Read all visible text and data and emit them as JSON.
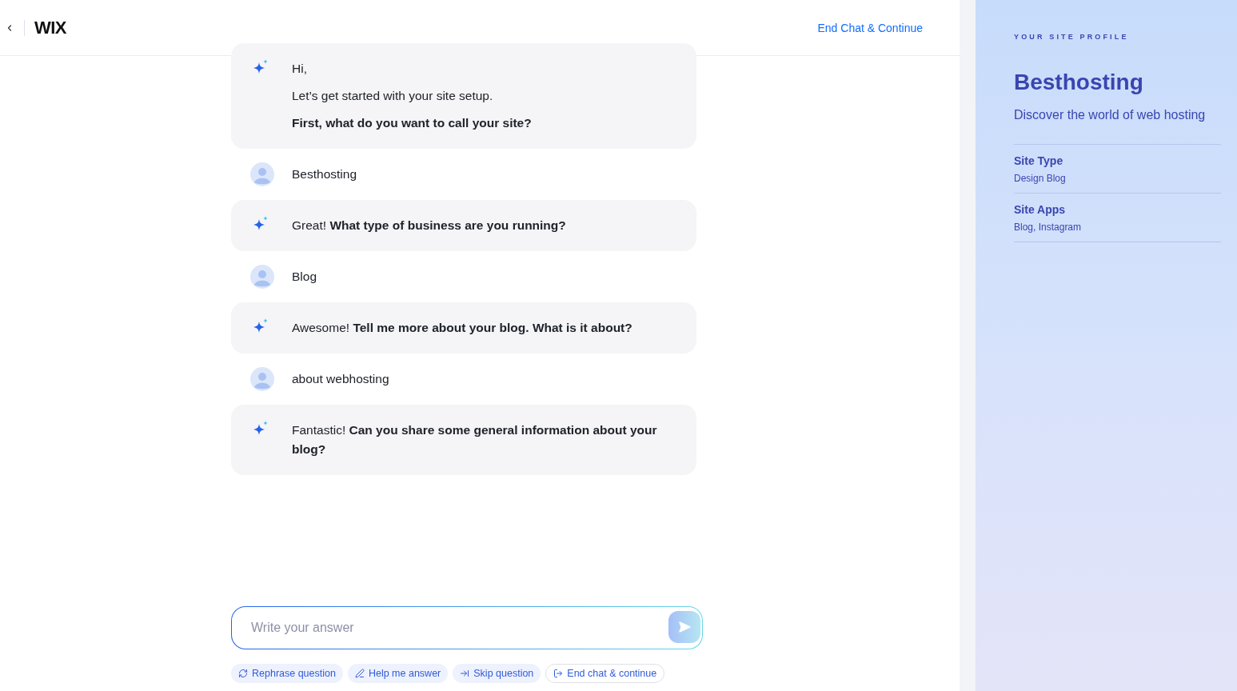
{
  "header": {
    "logo": "WIX",
    "end_link": "End Chat & Continue"
  },
  "messages": [
    {
      "kind": "bot",
      "lines": [
        "Hi,",
        "Let’s get started with your site setup.",
        "**First, what do you want to call your site?**"
      ]
    },
    {
      "kind": "user",
      "lines": [
        "Besthosting"
      ]
    },
    {
      "kind": "bot",
      "lines": [
        "Great! **What type of business are you running?**"
      ]
    },
    {
      "kind": "user",
      "lines": [
        "Blog"
      ]
    },
    {
      "kind": "bot",
      "lines": [
        "Awesome! **Tell me more about your blog. What is it about?**"
      ]
    },
    {
      "kind": "user",
      "lines": [
        "about webhosting"
      ]
    },
    {
      "kind": "bot",
      "lines": [
        "Fantastic! **Can you share some general information about your blog?**"
      ]
    }
  ],
  "answer": {
    "placeholder": "Write your answer"
  },
  "actions": [
    {
      "kind": "rephrase",
      "label": "Rephrase question"
    },
    {
      "kind": "help",
      "label": "Help me answer"
    },
    {
      "kind": "skip",
      "label": "Skip question"
    },
    {
      "kind": "end",
      "label": "End chat & continue"
    }
  ],
  "profile": {
    "heading": "YOUR SITE PROFILE",
    "site_name": "Besthosting",
    "tagline": "Discover the world of web hosting",
    "fields": [
      {
        "label": "Site Type",
        "value": "Design Blog"
      },
      {
        "label": "Site Apps",
        "value": "Blog, Instagram"
      }
    ]
  }
}
